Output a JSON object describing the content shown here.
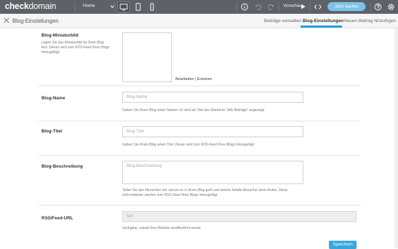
{
  "topbar": {
    "logo_bold": "check",
    "logo_rest": "domain",
    "page_select": "Home",
    "preview_label": "Vorschau",
    "buy_label": "Jetzt kaufen"
  },
  "subheader": {
    "title": "Blog-Einstellungen",
    "tabs": [
      {
        "label": "Beiträge verwalten"
      },
      {
        "label": "Blog-Einstellungen"
      },
      {
        "label": "Neuen Beitrag hinzufügen"
      }
    ]
  },
  "form": {
    "thumbnail": {
      "label": "Blog-Miniaturbild",
      "description": "Legen Sie das Miniaturbild für Ihren Blog fest. Dieses wird zum RSS-Feed Ihres Blogs hinzugefügt.",
      "edit_link": "Bearbeiten",
      "separator": "|",
      "replace_link": "Ersetzen"
    },
    "name": {
      "label": "Blog-Name",
      "placeholder": "Blog-Name",
      "hint": "Geben Sie Ihrem Blog einen Namen. Er wird als Titel des Elements \"Alle Beiträge\" angezeigt."
    },
    "title": {
      "label": "Blog-Titel",
      "placeholder": "Blog-Titel",
      "hint": "Geben Sie Ihrem Blog einen Titel. Dieser wird zum RSS-Feed Ihres Blogs hinzugefügt."
    },
    "description": {
      "label": "Blog-Beschreibung",
      "placeholder": "Blog-Beschreibung",
      "hint": "Teilen Sie den Menschen mit, worum es in Ihrem Blog geht und welche Inhalte Besucher darin finden. Diese Informationen werden zum RSS-Feed Ihres Blogs hinzugefügt."
    },
    "rss": {
      "label": "RSS/Feed-URL",
      "value": "N/A",
      "hint": "Verfügbar, sobald Ihre Website veröffentlicht wurde."
    },
    "save_label": "Speichern"
  }
}
